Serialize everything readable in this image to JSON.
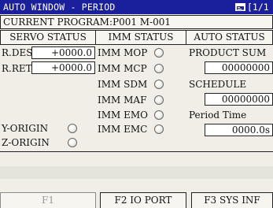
{
  "title": {
    "text": "AUTO WINDOW - PERIOD",
    "page": "[1/1"
  },
  "program": {
    "text": "CURRENT PROGRAM:P001 M-001"
  },
  "tabs": [
    "SERVO STATUS",
    "IMM STATUS",
    "AUTO STATUS"
  ],
  "servo": {
    "r_des_label": "R.DES",
    "r_des_value": "+0000.0",
    "r_ret_label": "R.RET",
    "r_ret_value": "+0000.0",
    "y_origin_label": "Y-ORIGIN",
    "z_origin_label": "Z-ORIGIN"
  },
  "imm": [
    "IMM MOP",
    "IMM MCP",
    "IMM SDM",
    "IMM MAF",
    "IMM EMO",
    "IMM EMC"
  ],
  "auto": {
    "product_sum_label": "PRODUCT SUM",
    "product_sum_value": "00000000",
    "schedule_label": "SCHEDULE",
    "schedule_value": "00000000",
    "period_time_label": "Period Time",
    "period_time_value": "0000.0s"
  },
  "function_keys": {
    "f1": "F1",
    "f2": "F2 IO PORT",
    "f3": "F3 SYS INF"
  },
  "colors": {
    "title_bg": "#1a1f9c",
    "title_fg": "#ffffff",
    "panel_bg": "#f0eee6"
  },
  "icons": {
    "window": "window-icon",
    "indicator": "indicator-lamp-icon"
  }
}
